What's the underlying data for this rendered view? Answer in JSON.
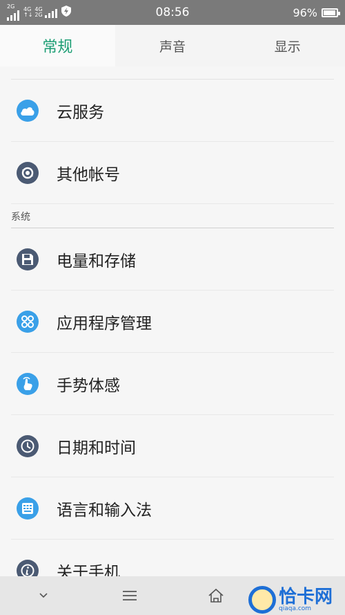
{
  "status_bar": {
    "sim1": "2G",
    "sim2_top": "4G",
    "sim2_mid": "4G",
    "sim2_bot": "2G",
    "time": "08:56",
    "battery_pct": "96%",
    "battery_level": 0.96
  },
  "tabs": [
    {
      "label": "常规",
      "active": true
    },
    {
      "label": "声音",
      "active": false
    },
    {
      "label": "显示",
      "active": false
    }
  ],
  "accounts": [
    {
      "label": "云服务",
      "icon": "cloud-icon"
    },
    {
      "label": "其他帐号",
      "icon": "sync-account-icon"
    }
  ],
  "system_section": {
    "title": "系统",
    "items": [
      {
        "label": "电量和存储",
        "icon": "storage-icon"
      },
      {
        "label": "应用程序管理",
        "icon": "apps-icon"
      },
      {
        "label": "手势体感",
        "icon": "gesture-icon"
      },
      {
        "label": "日期和时间",
        "icon": "clock-icon"
      },
      {
        "label": "语言和输入法",
        "icon": "keyboard-icon"
      },
      {
        "label": "关于手机",
        "icon": "info-icon"
      }
    ]
  },
  "watermark": {
    "text": "恰卡网",
    "sub": "qiaqa.com"
  },
  "colors": {
    "accent": "#1c9e74",
    "icon_blue": "#3aa0e8",
    "icon_slate": "#4b5a73"
  }
}
